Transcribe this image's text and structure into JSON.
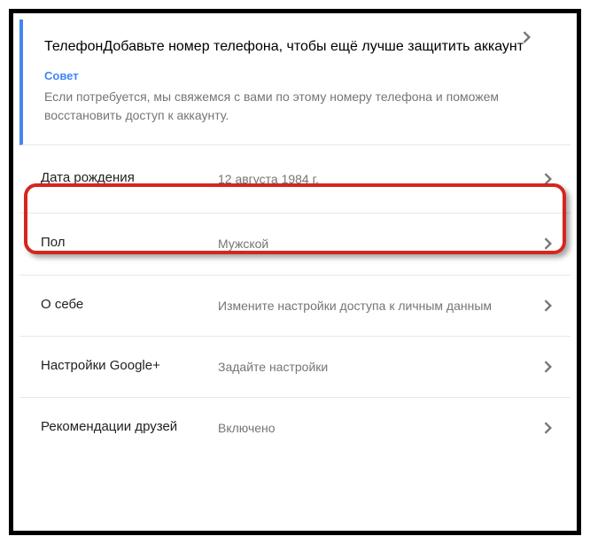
{
  "phone": {
    "label": "Телефон",
    "value": "Добавьте номер телефона, чтобы ещё лучше защитить аккаунт",
    "advice_title": "Совет",
    "advice_text": "Если потребуется, мы свяжемся с вами по этому номеру телефона и поможем восстановить доступ к аккаунту."
  },
  "birthday": {
    "label": "Дата рождения",
    "value": "12 августа 1984 г."
  },
  "gender": {
    "label": "Пол",
    "value": "Мужской"
  },
  "about": {
    "label": "О себе",
    "value": "Измените настройки доступа к личным данным"
  },
  "gplus": {
    "label": "Настройки Google+",
    "value": "Задайте настройки"
  },
  "recommend": {
    "label": "Рекомендации друзей",
    "value": "Включено"
  }
}
